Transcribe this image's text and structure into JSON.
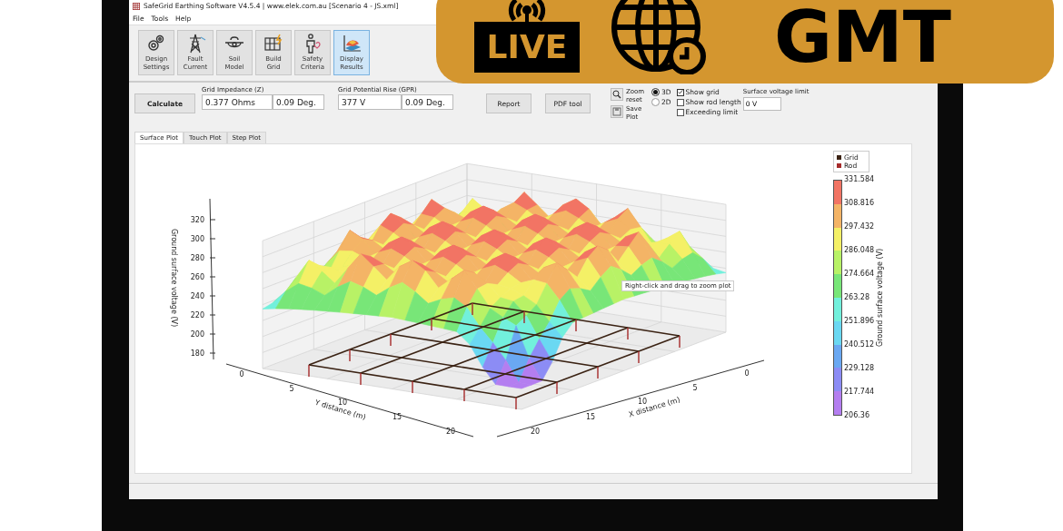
{
  "window": {
    "title": "SafeGrid Earthing Software V4.5.4 | www.elek.com.au [Scenario 4 - JS.xml]"
  },
  "menu": [
    "File",
    "Tools",
    "Help"
  ],
  "toolbar": [
    {
      "kind": "gears",
      "label": "Design Settings",
      "selected": false
    },
    {
      "kind": "tower",
      "label": "Fault Current",
      "selected": false
    },
    {
      "kind": "soil",
      "label": "Soil Model",
      "selected": false
    },
    {
      "kind": "grid",
      "label": "Build Grid",
      "selected": false
    },
    {
      "kind": "person",
      "label": "Safety Criteria",
      "selected": false
    },
    {
      "kind": "results",
      "label": "Display Results",
      "selected": true
    }
  ],
  "calculate_button": "Calculate",
  "impedance": {
    "label": "Grid Impedance (Z)",
    "magnitude": "0.377 Ohms",
    "angle": "0.09 Deg."
  },
  "gpr": {
    "label": "Grid Potential Rise (GPR)",
    "magnitude": "377 V",
    "angle": "0.09 Deg."
  },
  "report_button": "Report",
  "pdf_button": "PDF tool",
  "zoom_reset": "Zoom reset",
  "save_plot": "Save Plot",
  "view_modes": [
    {
      "label": "3D",
      "selected": true
    },
    {
      "label": "2D",
      "selected": false
    }
  ],
  "options": [
    {
      "label": "Show grid",
      "checked": true
    },
    {
      "label": "Show rod length",
      "checked": false
    },
    {
      "label": "Exceeding limit",
      "checked": false
    }
  ],
  "voltage_limit": {
    "label": "Surface voltage limit",
    "value": "0 V"
  },
  "tabs": [
    {
      "label": "Surface Plot",
      "selected": true
    },
    {
      "label": "Touch Plot",
      "selected": false
    },
    {
      "label": "Step Plot",
      "selected": false
    }
  ],
  "plot": {
    "z_label": "Ground surface voltage (V)",
    "z_ticks": [
      "320",
      "300",
      "280",
      "260",
      "240",
      "220",
      "200",
      "180"
    ],
    "y_label": "Y distance (m)",
    "y_ticks": [
      "0",
      "5",
      "10",
      "15",
      "20"
    ],
    "x_label": "X distance (m)",
    "x_ticks": [
      "20",
      "15",
      "10",
      "5",
      "0"
    ],
    "tooltip": "Right-click and drag to zoom plot",
    "legend": [
      {
        "label": "Grid",
        "color": "#3b2314"
      },
      {
        "label": "Rod",
        "color": "#a52a2a"
      }
    ],
    "colorbar": {
      "label": "Ground surface voltage (V)",
      "ticks": [
        "331.584",
        "308.816",
        "297.432",
        "286.048",
        "274.664",
        "263.28",
        "251.896",
        "240.512",
        "229.128",
        "217.744",
        "206.36"
      ]
    }
  },
  "banner": {
    "live": "LIVE",
    "text": "GMT"
  }
}
